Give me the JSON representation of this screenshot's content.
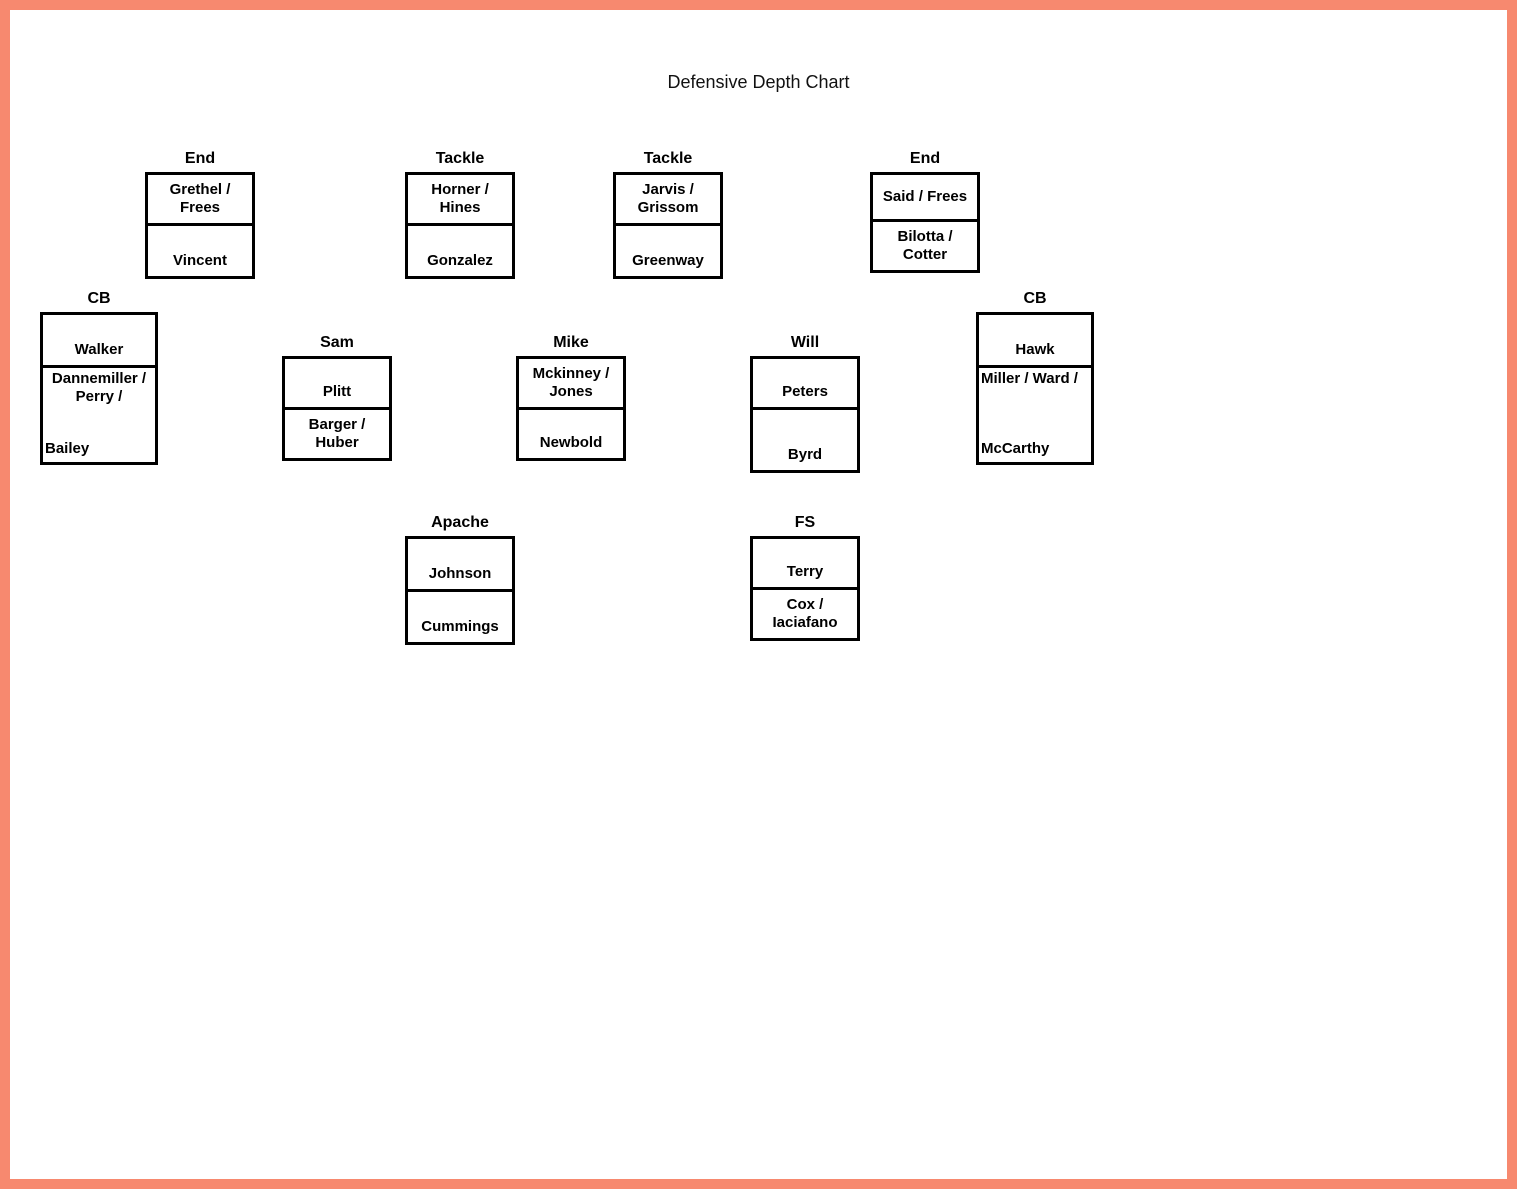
{
  "title": "Defensive Depth Chart",
  "row1": {
    "end_left": {
      "label": "End",
      "starter": "Grethel / Frees",
      "backup": "Vincent"
    },
    "tackle_left": {
      "label": "Tackle",
      "starter": "Horner / Hines",
      "backup": "Gonzalez"
    },
    "tackle_right": {
      "label": "Tackle",
      "starter": "Jarvis / Grissom",
      "backup": "Greenway"
    },
    "end_right": {
      "label": "End",
      "starter": "Said / Frees",
      "backup": "Bilotta / Cotter"
    }
  },
  "row2": {
    "cb_left": {
      "label": "CB",
      "starter": "Walker",
      "backup_top": "Dannemiller / Perry /",
      "backup_bottom": "Bailey"
    },
    "sam": {
      "label": "Sam",
      "starter": "Plitt",
      "backup": "Barger / Huber"
    },
    "mike": {
      "label": "Mike",
      "starter": "Mckinney / Jones",
      "backup": "Newbold"
    },
    "will": {
      "label": "Will",
      "starter": "Peters",
      "backup": "Byrd"
    },
    "cb_right": {
      "label": "CB",
      "starter": "Hawk",
      "backup_top": "Miller / Ward /",
      "backup_bottom": "McCarthy"
    }
  },
  "row3": {
    "apache": {
      "label": "Apache",
      "starter": "Johnson",
      "backup": "Cummings"
    },
    "fs": {
      "label": "FS",
      "starter": "Terry",
      "backup": "Cox / Iaciafano"
    }
  }
}
